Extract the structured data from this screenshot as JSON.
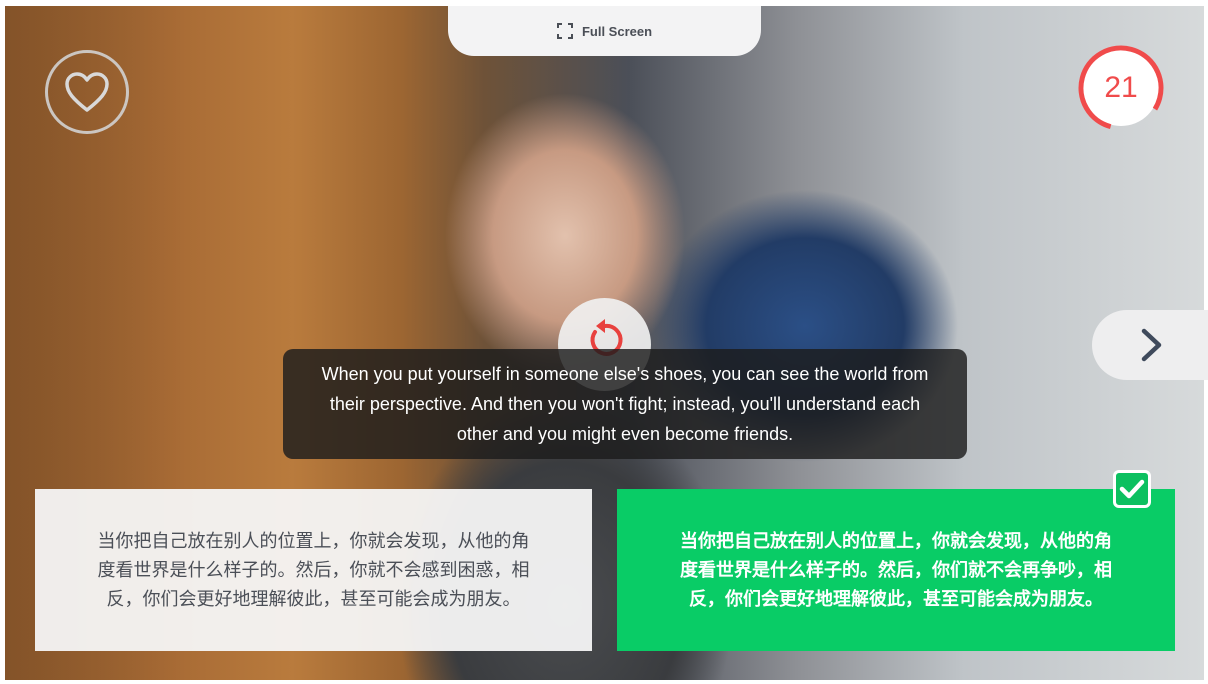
{
  "toolbar": {
    "fullscreen_label": "Full Screen"
  },
  "timer": {
    "value": "21",
    "color": "#f04b4b"
  },
  "caption": {
    "text": "When you put yourself in someone else's shoes, you can see the world from their perspective. And then you won't fight; instead, you'll understand each other and you might even become friends."
  },
  "options": [
    {
      "text": "当你把自己放在别人的位置上，你就会发现，从他的角度看世界是什么样子的。然后，你就不会感到困惑，相反，你们会更好地理解彼此，甚至可能会成为朋友。",
      "selected": false
    },
    {
      "text": "当你把自己放在别人的位置上，你就会发现，从他的角度看世界是什么样子的。然后，你们就不会再争吵，相反，你们会更好地理解彼此，甚至可能会成为朋友。",
      "selected": true
    }
  ],
  "icons": {
    "favorite": "heart-outline-icon",
    "fullscreen": "expand-icon",
    "replay": "replay-icon",
    "next": "chevron-right-icon",
    "selected": "checkmark-icon"
  },
  "colors": {
    "correct": "#09cc66",
    "accent": "#f04b4b"
  }
}
